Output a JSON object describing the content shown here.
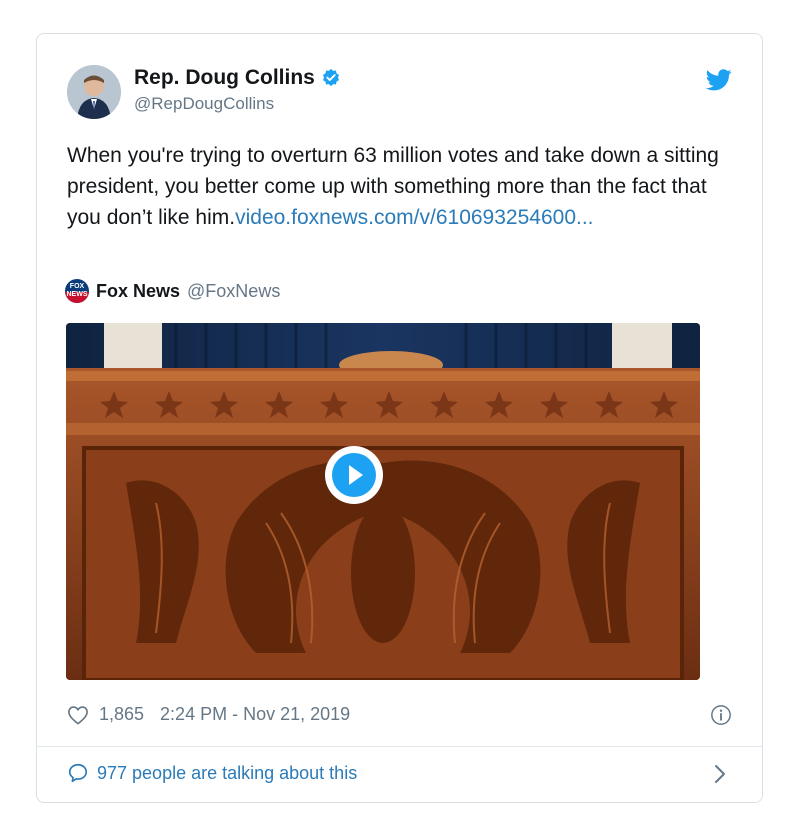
{
  "author": {
    "name": "Rep. Doug Collins",
    "handle": "@RepDougCollins"
  },
  "tweet": {
    "text": "When you're trying to overturn 63 million votes and take down a sitting president, you better come up with something more than the fact that you don’t like him.",
    "link_text": "video.foxnews.com/v/610693254600..."
  },
  "quoted": {
    "source_name": "Fox News",
    "source_handle": "@FoxNews",
    "logo_text": "FOX NEWS"
  },
  "stats": {
    "likes": "1,865",
    "timestamp": "2:24 PM - Nov 21, 2019"
  },
  "conversation": {
    "label": "977 people are talking about this"
  },
  "colors": {
    "link": "#2b7bb9",
    "twitter_blue": "#1da1f2",
    "muted": "#657786"
  },
  "icons": [
    "verified-icon",
    "twitter-bird-icon",
    "heart-icon",
    "info-icon",
    "comment-icon",
    "chevron-right-icon",
    "play-icon"
  ]
}
